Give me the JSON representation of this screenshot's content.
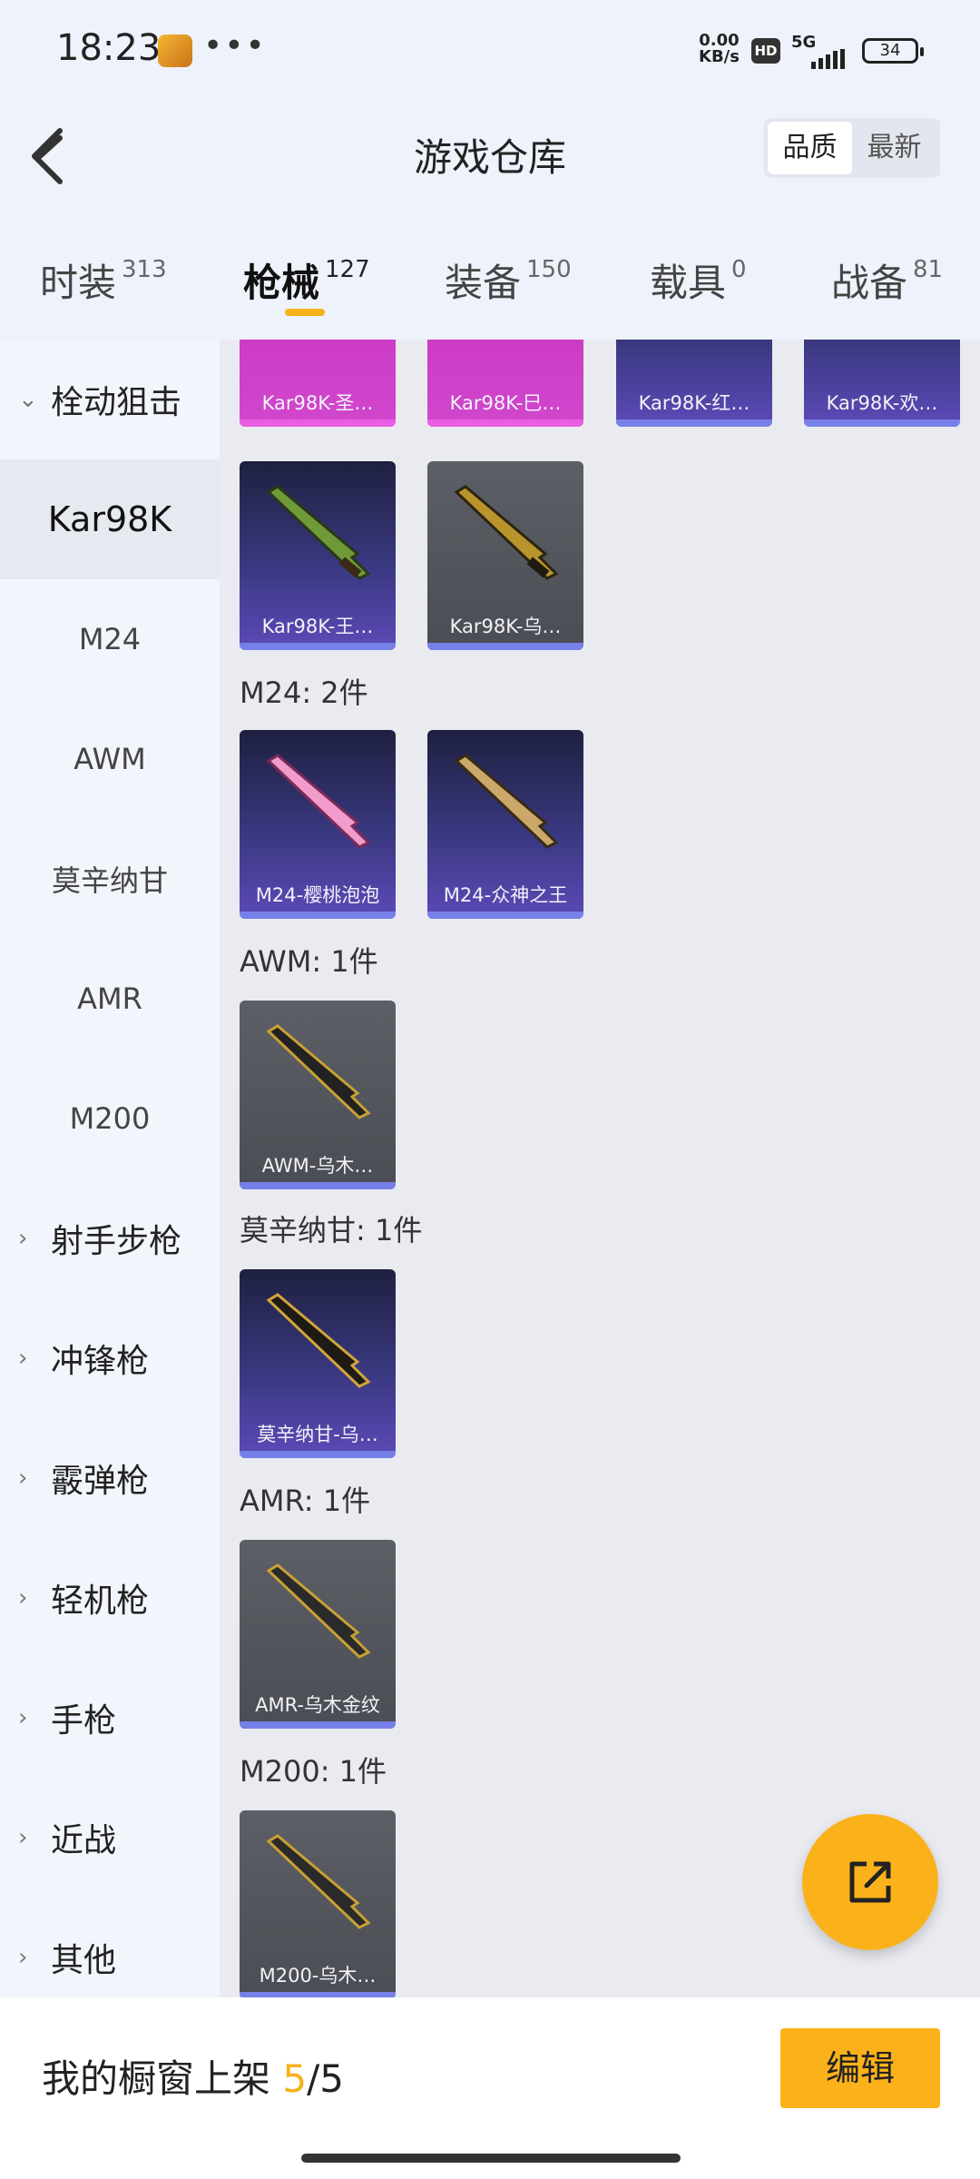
{
  "status": {
    "time": "18:23",
    "more": "•••",
    "net_speed_top": "0.00",
    "net_speed_bottom": "KB/s",
    "hd": "HD",
    "network": "5G",
    "battery": "34"
  },
  "header": {
    "title": "游戏仓库",
    "sort_quality": "品质",
    "sort_latest": "最新"
  },
  "tabs": [
    {
      "label": "时装",
      "count": "313"
    },
    {
      "label": "枪械",
      "count": "127"
    },
    {
      "label": "装备",
      "count": "150"
    },
    {
      "label": "载具",
      "count": "0"
    },
    {
      "label": "战备",
      "count": "81"
    }
  ],
  "sidebar": {
    "items": [
      {
        "label": "栓动狙击",
        "type": "category",
        "expanded": true
      },
      {
        "label": "Kar98K",
        "type": "sub",
        "selected": true
      },
      {
        "label": "M24",
        "type": "sub"
      },
      {
        "label": "AWM",
        "type": "sub"
      },
      {
        "label": "莫辛纳甘",
        "type": "sub"
      },
      {
        "label": "AMR",
        "type": "sub"
      },
      {
        "label": "M200",
        "type": "sub"
      },
      {
        "label": "射手步枪",
        "type": "category"
      },
      {
        "label": "冲锋枪",
        "type": "category"
      },
      {
        "label": "霰弹枪",
        "type": "category"
      },
      {
        "label": "轻机枪",
        "type": "category"
      },
      {
        "label": "手枪",
        "type": "category"
      },
      {
        "label": "近战",
        "type": "category"
      },
      {
        "label": "其他",
        "type": "category"
      }
    ]
  },
  "content": {
    "top_row": [
      "Kar98K-圣…",
      "Kar98K-巳…",
      "Kar98K-红…",
      "Kar98K-欢…"
    ],
    "kar_row2": [
      "Kar98K-王…",
      "Kar98K-乌…"
    ],
    "groups": [
      {
        "title": "M24: 2件",
        "items": [
          "M24-樱桃泡泡",
          "M24-众神之王"
        ]
      },
      {
        "title": "AWM: 1件",
        "items": [
          "AWM-乌木…"
        ]
      },
      {
        "title": "莫辛纳甘: 1件",
        "items": [
          "莫辛纳甘-乌…"
        ]
      },
      {
        "title": "AMR: 1件",
        "items": [
          "AMR-乌木金纹"
        ]
      },
      {
        "title": "M200: 1件",
        "items": [
          "M200-乌木…"
        ]
      }
    ]
  },
  "bottom": {
    "showcase_label": "我的橱窗上架",
    "showcase_current": "5",
    "showcase_sep": "/",
    "showcase_total": "5",
    "edit_label": "编辑"
  },
  "colors": {
    "accent": "#fbb21a",
    "rarity_purple": "#5c4ab8",
    "rarity_pink": "#d047cc",
    "rarity_gray": "#4b4d54"
  },
  "icons": [
    "back-arrow-icon",
    "share-icon",
    "chevron-down-icon",
    "chevron-right-icon"
  ]
}
